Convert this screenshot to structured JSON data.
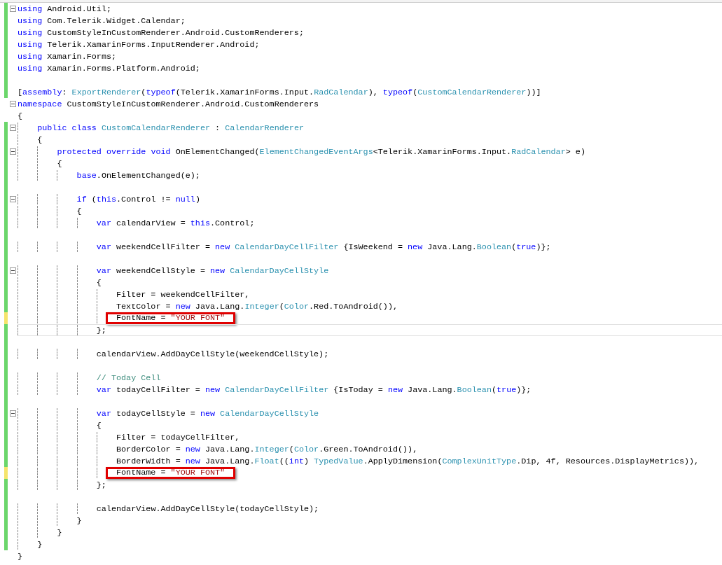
{
  "editor": {
    "lines": [
      {
        "color": "#6bd66b",
        "fold": true,
        "current": false,
        "highlighted": false,
        "tokens": [
          {
            "kind": "kw",
            "text": "using"
          },
          {
            "kind": "plain",
            "text": " Android.Util;"
          }
        ]
      },
      {
        "color": "#6bd66b",
        "fold": false,
        "current": false,
        "highlighted": false,
        "tokens": [
          {
            "kind": "kw",
            "text": "using"
          },
          {
            "kind": "plain",
            "text": " Com.Telerik.Widget.Calendar;"
          }
        ]
      },
      {
        "color": "#6bd66b",
        "fold": false,
        "current": false,
        "highlighted": false,
        "tokens": [
          {
            "kind": "kw",
            "text": "using"
          },
          {
            "kind": "plain",
            "text": " CustomStyleInCustomRenderer.Android.CustomRenderers;"
          }
        ]
      },
      {
        "color": "#6bd66b",
        "fold": false,
        "current": false,
        "highlighted": false,
        "tokens": [
          {
            "kind": "kw",
            "text": "using"
          },
          {
            "kind": "plain",
            "text": " Telerik.XamarinForms.InputRenderer.Android;"
          }
        ]
      },
      {
        "color": "#6bd66b",
        "fold": false,
        "current": false,
        "highlighted": false,
        "tokens": [
          {
            "kind": "kw",
            "text": "using"
          },
          {
            "kind": "plain",
            "text": " Xamarin.Forms;"
          }
        ]
      },
      {
        "color": "#6bd66b",
        "fold": false,
        "current": false,
        "highlighted": false,
        "tokens": [
          {
            "kind": "kw",
            "text": "using"
          },
          {
            "kind": "plain",
            "text": " Xamarin.Forms.Platform.Android;"
          }
        ]
      },
      {
        "color": "#6bd66b",
        "fold": false,
        "current": false,
        "highlighted": false
      },
      {
        "color": "#6bd66b",
        "fold": false,
        "current": false,
        "highlighted": false,
        "tokens": [
          {
            "kind": "plain",
            "text": "["
          },
          {
            "kind": "kw",
            "text": "assembly"
          },
          {
            "kind": "plain",
            "text": ": "
          },
          {
            "kind": "type",
            "text": "ExportRenderer"
          },
          {
            "kind": "plain",
            "text": "("
          },
          {
            "kind": "kw",
            "text": "typeof"
          },
          {
            "kind": "plain",
            "text": "(Telerik.XamarinForms.Input."
          },
          {
            "kind": "type",
            "text": "RadCalendar"
          },
          {
            "kind": "plain",
            "text": "), "
          },
          {
            "kind": "kw",
            "text": "typeof"
          },
          {
            "kind": "plain",
            "text": "("
          },
          {
            "kind": "type",
            "text": "CustomCalendarRenderer"
          },
          {
            "kind": "plain",
            "text": "))]"
          }
        ]
      },
      {
        "fold": true,
        "current": false,
        "highlighted": false,
        "tokens": [
          {
            "kind": "kw",
            "text": "namespace"
          },
          {
            "kind": "plain",
            "text": " CustomStyleInCustomRenderer.Android.CustomRenderers"
          }
        ]
      },
      {
        "fold": false,
        "current": false,
        "highlighted": false,
        "tokens": [
          {
            "kind": "plain",
            "text": "{"
          }
        ]
      },
      {
        "color": "#6bd66b",
        "fold": true,
        "current": false,
        "highlighted": false,
        "tokens": [
          {
            "kind": "kw",
            "text": "    public"
          },
          {
            "kind": "kw",
            "text": " class"
          },
          {
            "kind": "type",
            "text": " CustomCalendarRenderer"
          },
          {
            "kind": "plain",
            "text": " : "
          },
          {
            "kind": "type",
            "text": "CalendarRenderer"
          }
        ]
      },
      {
        "color": "#6bd66b",
        "fold": false,
        "current": false,
        "highlighted": false,
        "tokens": [
          {
            "kind": "plain",
            "text": "    {"
          }
        ]
      },
      {
        "color": "#6bd66b",
        "fold": true,
        "current": false,
        "highlighted": false,
        "tokens": [
          {
            "kind": "kw",
            "text": "        protected"
          },
          {
            "kind": "kw",
            "text": " override"
          },
          {
            "kind": "kw",
            "text": " void"
          },
          {
            "kind": "plain",
            "text": " OnElementChanged("
          },
          {
            "kind": "type",
            "text": "ElementChangedEventArgs"
          },
          {
            "kind": "plain",
            "text": "<Telerik.XamarinForms.Input."
          },
          {
            "kind": "type",
            "text": "RadCalendar"
          },
          {
            "kind": "plain",
            "text": "> e)"
          }
        ]
      },
      {
        "color": "#6bd66b",
        "fold": false,
        "current": false,
        "highlighted": false,
        "tokens": [
          {
            "kind": "plain",
            "text": "        {"
          }
        ]
      },
      {
        "color": "#6bd66b",
        "fold": false,
        "current": false,
        "highlighted": false,
        "tokens": [
          {
            "kind": "kw",
            "text": "            base"
          },
          {
            "kind": "plain",
            "text": ".OnElementChanged(e);"
          }
        ]
      },
      {
        "color": "#6bd66b",
        "fold": false,
        "current": false,
        "highlighted": false
      },
      {
        "color": "#6bd66b",
        "fold": true,
        "current": false,
        "highlighted": false,
        "tokens": [
          {
            "kind": "kw",
            "text": "            if"
          },
          {
            "kind": "plain",
            "text": " ("
          },
          {
            "kind": "kw",
            "text": "this"
          },
          {
            "kind": "plain",
            "text": ".Control != "
          },
          {
            "kind": "kw",
            "text": "null"
          },
          {
            "kind": "plain",
            "text": ")"
          }
        ]
      },
      {
        "color": "#6bd66b",
        "fold": false,
        "current": false,
        "highlighted": false,
        "tokens": [
          {
            "kind": "plain",
            "text": "            {"
          }
        ]
      },
      {
        "color": "#6bd66b",
        "fold": false,
        "current": false,
        "highlighted": false,
        "tokens": [
          {
            "kind": "kw",
            "text": "                var"
          },
          {
            "kind": "plain",
            "text": " calendarView = "
          },
          {
            "kind": "kw",
            "text": "this"
          },
          {
            "kind": "plain",
            "text": ".Control;"
          }
        ]
      },
      {
        "color": "#6bd66b",
        "fold": false,
        "current": false,
        "highlighted": false
      },
      {
        "color": "#6bd66b",
        "fold": false,
        "current": false,
        "highlighted": false,
        "tokens": [
          {
            "kind": "kw",
            "text": "                var"
          },
          {
            "kind": "plain",
            "text": " weekendCellFilter = "
          },
          {
            "kind": "kw",
            "text": "new"
          },
          {
            "kind": "type",
            "text": " CalendarDayCellFilter"
          },
          {
            "kind": "plain",
            "text": " {IsWeekend = "
          },
          {
            "kind": "kw",
            "text": "new"
          },
          {
            "kind": "plain",
            "text": " Java.Lang."
          },
          {
            "kind": "type",
            "text": "Boolean"
          },
          {
            "kind": "plain",
            "text": "("
          },
          {
            "kind": "kw",
            "text": "true"
          },
          {
            "kind": "plain",
            "text": ")};"
          }
        ]
      },
      {
        "color": "#6bd66b",
        "fold": false,
        "current": false,
        "highlighted": false
      },
      {
        "color": "#6bd66b",
        "fold": true,
        "current": false,
        "highlighted": false,
        "tokens": [
          {
            "kind": "kw",
            "text": "                var"
          },
          {
            "kind": "plain",
            "text": " weekendCellStyle = "
          },
          {
            "kind": "kw",
            "text": "new"
          },
          {
            "kind": "type",
            "text": " CalendarDayCellStyle"
          }
        ]
      },
      {
        "color": "#6bd66b",
        "fold": false,
        "current": false,
        "highlighted": false,
        "tokens": [
          {
            "kind": "plain",
            "text": "                {"
          }
        ]
      },
      {
        "color": "#6bd66b",
        "fold": false,
        "current": false,
        "highlighted": false,
        "tokens": [
          {
            "kind": "plain",
            "text": "                    Filter = weekendCellFilter,"
          }
        ]
      },
      {
        "color": "#6bd66b",
        "fold": false,
        "current": false,
        "highlighted": false,
        "tokens": [
          {
            "kind": "plain",
            "text": "                    TextColor = "
          },
          {
            "kind": "kw",
            "text": "new"
          },
          {
            "kind": "plain",
            "text": " Java.Lang."
          },
          {
            "kind": "type",
            "text": "Integer"
          },
          {
            "kind": "plain",
            "text": "("
          },
          {
            "kind": "type",
            "text": "Color"
          },
          {
            "kind": "plain",
            "text": ".Red.ToAndroid()),"
          }
        ]
      },
      {
        "color": "#f5e46c",
        "fold": false,
        "current": false,
        "highlighted": true,
        "tokens": [
          {
            "kind": "plain",
            "text": "                    FontName = "
          },
          {
            "kind": "str",
            "text": "\"YOUR FONT\""
          }
        ]
      },
      {
        "color": "#6bd66b",
        "fold": false,
        "current": true,
        "highlighted": false,
        "tokens": [
          {
            "kind": "plain",
            "text": "                };"
          }
        ]
      },
      {
        "color": "#6bd66b",
        "fold": false,
        "current": false,
        "highlighted": false
      },
      {
        "color": "#6bd66b",
        "fold": false,
        "current": false,
        "highlighted": false,
        "tokens": [
          {
            "kind": "plain",
            "text": "                calendarView.AddDayCellStyle(weekendCellStyle);"
          }
        ]
      },
      {
        "color": "#6bd66b",
        "fold": false,
        "current": false,
        "highlighted": false
      },
      {
        "color": "#6bd66b",
        "fold": false,
        "current": false,
        "highlighted": false,
        "tokens": [
          {
            "kind": "cmt",
            "text": "                // Today Cell"
          }
        ]
      },
      {
        "color": "#6bd66b",
        "fold": false,
        "current": false,
        "highlighted": false,
        "tokens": [
          {
            "kind": "kw",
            "text": "                var"
          },
          {
            "kind": "plain",
            "text": " todayCellFilter = "
          },
          {
            "kind": "kw",
            "text": "new"
          },
          {
            "kind": "type",
            "text": " CalendarDayCellFilter"
          },
          {
            "kind": "plain",
            "text": " {IsToday = "
          },
          {
            "kind": "kw",
            "text": "new"
          },
          {
            "kind": "plain",
            "text": " Java.Lang."
          },
          {
            "kind": "type",
            "text": "Boolean"
          },
          {
            "kind": "plain",
            "text": "("
          },
          {
            "kind": "kw",
            "text": "true"
          },
          {
            "kind": "plain",
            "text": ")};"
          }
        ]
      },
      {
        "color": "#6bd66b",
        "fold": false,
        "current": false,
        "highlighted": false
      },
      {
        "color": "#6bd66b",
        "fold": true,
        "current": false,
        "highlighted": false,
        "tokens": [
          {
            "kind": "kw",
            "text": "                var"
          },
          {
            "kind": "plain",
            "text": " todayCellStyle = "
          },
          {
            "kind": "kw",
            "text": "new"
          },
          {
            "kind": "type",
            "text": " CalendarDayCellStyle"
          }
        ]
      },
      {
        "color": "#6bd66b",
        "fold": false,
        "current": false,
        "highlighted": false,
        "tokens": [
          {
            "kind": "plain",
            "text": "                {"
          }
        ]
      },
      {
        "color": "#6bd66b",
        "fold": false,
        "current": false,
        "highlighted": false,
        "tokens": [
          {
            "kind": "plain",
            "text": "                    Filter = todayCellFilter,"
          }
        ]
      },
      {
        "color": "#6bd66b",
        "fold": false,
        "current": false,
        "highlighted": false,
        "tokens": [
          {
            "kind": "plain",
            "text": "                    BorderColor = "
          },
          {
            "kind": "kw",
            "text": "new"
          },
          {
            "kind": "plain",
            "text": " Java.Lang."
          },
          {
            "kind": "type",
            "text": "Integer"
          },
          {
            "kind": "plain",
            "text": "("
          },
          {
            "kind": "type",
            "text": "Color"
          },
          {
            "kind": "plain",
            "text": ".Green.ToAndroid()),"
          }
        ]
      },
      {
        "color": "#6bd66b",
        "fold": false,
        "current": false,
        "highlighted": false,
        "tokens": [
          {
            "kind": "plain",
            "text": "                    BorderWidth = "
          },
          {
            "kind": "kw",
            "text": "new"
          },
          {
            "kind": "plain",
            "text": " Java.Lang."
          },
          {
            "kind": "type",
            "text": "Float"
          },
          {
            "kind": "plain",
            "text": "(("
          },
          {
            "kind": "kw",
            "text": "int"
          },
          {
            "kind": "plain",
            "text": ") "
          },
          {
            "kind": "type",
            "text": "TypedValue"
          },
          {
            "kind": "plain",
            "text": ".ApplyDimension("
          },
          {
            "kind": "type",
            "text": "ComplexUnitType"
          },
          {
            "kind": "plain",
            "text": ".Dip, 4f, Resources.DisplayMetrics)),"
          }
        ]
      },
      {
        "color": "#f5e46c",
        "fold": false,
        "current": false,
        "highlighted": true,
        "tokens": [
          {
            "kind": "plain",
            "text": "                    FontName = "
          },
          {
            "kind": "str",
            "text": "\"YOUR FONT\""
          }
        ]
      },
      {
        "color": "#6bd66b",
        "fold": false,
        "current": false,
        "highlighted": false,
        "tokens": [
          {
            "kind": "plain",
            "text": "                };"
          }
        ]
      },
      {
        "color": "#6bd66b",
        "fold": false,
        "current": false,
        "highlighted": false
      },
      {
        "color": "#6bd66b",
        "fold": false,
        "current": false,
        "highlighted": false,
        "tokens": [
          {
            "kind": "plain",
            "text": "                calendarView.AddDayCellStyle(todayCellStyle);"
          }
        ]
      },
      {
        "color": "#6bd66b",
        "fold": false,
        "current": false,
        "highlighted": false,
        "tokens": [
          {
            "kind": "plain",
            "text": "            }"
          }
        ]
      },
      {
        "color": "#6bd66b",
        "fold": false,
        "current": false,
        "highlighted": false,
        "tokens": [
          {
            "kind": "plain",
            "text": "        }"
          }
        ]
      },
      {
        "color": "#6bd66b",
        "fold": false,
        "current": false,
        "highlighted": false,
        "tokens": [
          {
            "kind": "plain",
            "text": "    }"
          }
        ]
      },
      {
        "fold": false,
        "current": false,
        "highlighted": false,
        "tokens": [
          {
            "kind": "plain",
            "text": "}"
          }
        ]
      }
    ]
  }
}
